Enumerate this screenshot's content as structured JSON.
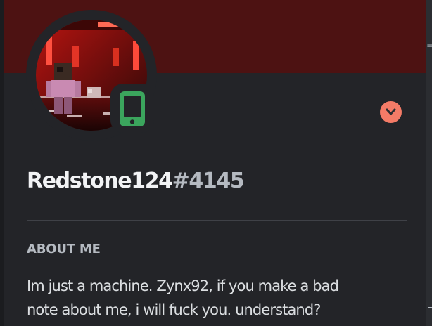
{
  "profile": {
    "username": "Redstone124",
    "discriminator": "#4145",
    "avatar_description": "redstone-avatar",
    "status": {
      "icon": "mobile-phone-icon",
      "color": "#3ba55d"
    },
    "badge": {
      "icon": "chevron-down-icon",
      "color": "#f47b67"
    },
    "banner_color": "#4d1212"
  },
  "about": {
    "title": "ABOUT ME",
    "lines": [
      "Im just a machine. Zynx92, if you make a bad",
      "note about me, i will fuck you. understand?"
    ]
  },
  "edge": {
    "glyph": "≡"
  }
}
